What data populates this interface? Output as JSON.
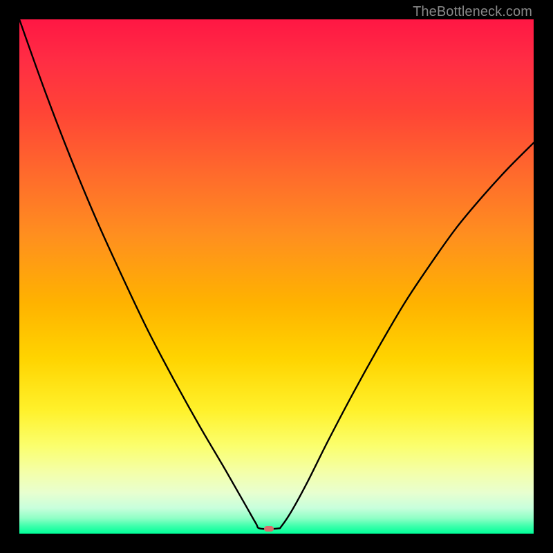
{
  "watermark": "TheBottleneck.com",
  "chart_data": {
    "type": "line",
    "title": "",
    "xlabel": "",
    "ylabel": "",
    "xlim": [
      0,
      100
    ],
    "ylim": [
      0,
      100
    ],
    "grid": false,
    "minimum_marker": {
      "x_pct": 48.5,
      "y_pct": 99.0,
      "color": "#d86d6d"
    },
    "curve": {
      "name": "v-curve",
      "points_pct": [
        {
          "x": 0.0,
          "y": 0.0
        },
        {
          "x": 5.0,
          "y": 14.0
        },
        {
          "x": 10.0,
          "y": 27.0
        },
        {
          "x": 15.0,
          "y": 39.0
        },
        {
          "x": 20.0,
          "y": 50.0
        },
        {
          "x": 25.0,
          "y": 60.5
        },
        {
          "x": 30.0,
          "y": 70.0
        },
        {
          "x": 35.0,
          "y": 79.0
        },
        {
          "x": 40.0,
          "y": 87.5
        },
        {
          "x": 44.0,
          "y": 94.5
        },
        {
          "x": 46.0,
          "y": 98.0
        },
        {
          "x": 46.8,
          "y": 99.0
        },
        {
          "x": 50.2,
          "y": 99.0
        },
        {
          "x": 51.0,
          "y": 98.5
        },
        {
          "x": 53.0,
          "y": 95.5
        },
        {
          "x": 56.0,
          "y": 90.0
        },
        {
          "x": 60.0,
          "y": 82.0
        },
        {
          "x": 65.0,
          "y": 72.5
        },
        {
          "x": 70.0,
          "y": 63.5
        },
        {
          "x": 75.0,
          "y": 55.0
        },
        {
          "x": 80.0,
          "y": 47.5
        },
        {
          "x": 85.0,
          "y": 40.5
        },
        {
          "x": 90.0,
          "y": 34.5
        },
        {
          "x": 95.0,
          "y": 29.0
        },
        {
          "x": 100.0,
          "y": 24.0
        }
      ]
    },
    "background_gradient_stops": [
      {
        "pos": 0.0,
        "color": "#ff1744"
      },
      {
        "pos": 0.3,
        "color": "#ff6a2c"
      },
      {
        "pos": 0.55,
        "color": "#ffb200"
      },
      {
        "pos": 0.76,
        "color": "#fff12b"
      },
      {
        "pos": 0.92,
        "color": "#e8ffcf"
      },
      {
        "pos": 1.0,
        "color": "#00ff99"
      }
    ]
  }
}
